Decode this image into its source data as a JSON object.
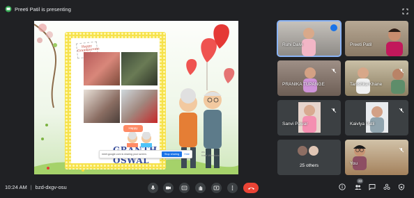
{
  "header": {
    "presenting_text": "Preeti Patil is presenting"
  },
  "slide": {
    "tag_text": "Happy Grandparents Day!",
    "title_line1": "GRANTH",
    "title_line2": "OSWAL",
    "sign_text": "Happy",
    "share_bar": {
      "message": "meet.google.com is sharing your screen.",
      "stop_label": "Stop sharing",
      "hide_label": "Hide"
    },
    "watermark_line1": "ws",
    "watermark_line2": "ivate Windows."
  },
  "participants": [
    {
      "name": "Ruhi Dalvi"
    },
    {
      "name": "Preeti Patil"
    },
    {
      "name": "PRANIKA TUPANGE"
    },
    {
      "name": "Tanishka Khane"
    },
    {
      "name": "Sanvi Pawar"
    },
    {
      "name": "Kaivlya Patil"
    },
    {
      "name": "25 others"
    },
    {
      "name": "You"
    }
  ],
  "footer": {
    "time": "10:24 AM",
    "separator": "|",
    "meeting_code": "bzd-dxgv-osu",
    "participants_badge": "33"
  },
  "colors": {
    "accent": "#8ab4f8",
    "end_call": "#ea4335",
    "background": "#202124",
    "tile": "#3c4043",
    "slide_frame": "#f6e24c"
  }
}
